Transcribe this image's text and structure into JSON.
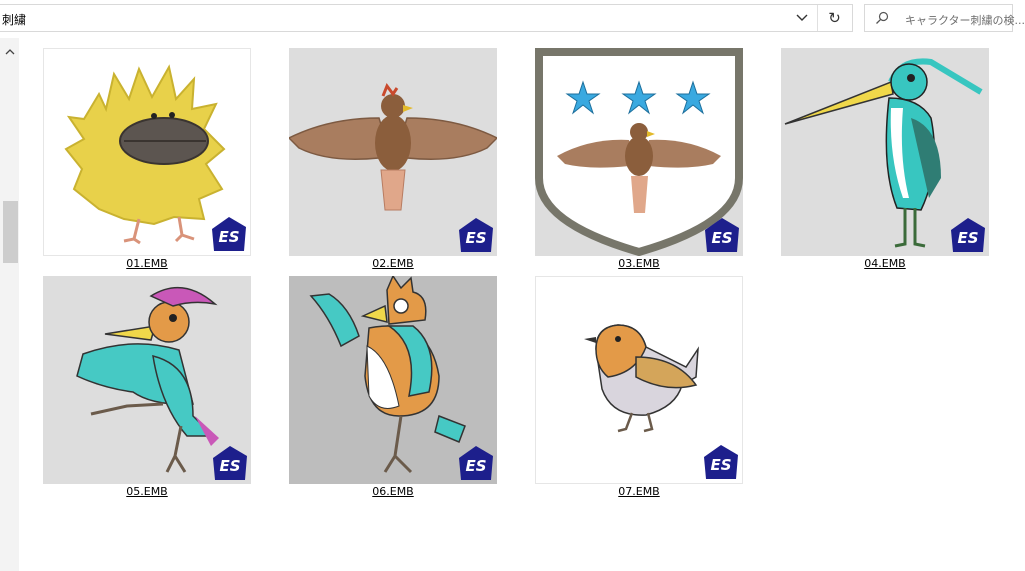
{
  "address_bar": {
    "path": "刺繍"
  },
  "search": {
    "placeholder": "キャラクター刺繍の検..."
  },
  "icons": {
    "dropdown": "chevron-down-icon",
    "refresh": "refresh-icon",
    "search": "search-icon",
    "scroll_up": "chevron-up-icon",
    "badge": "es-logo-icon"
  },
  "files": [
    {
      "name": "01.EMB",
      "bg": "#ffffff"
    },
    {
      "name": "02.EMB",
      "bg": "#dddddd"
    },
    {
      "name": "03.EMB",
      "bg": "#dddddd"
    },
    {
      "name": "04.EMB",
      "bg": "#dddddd"
    },
    {
      "name": "05.EMB",
      "bg": "#dddddd"
    },
    {
      "name": "06.EMB",
      "bg": "#bdbdbd"
    },
    {
      "name": "07.EMB",
      "bg": "#ffffff"
    }
  ],
  "badge_text": "ES"
}
